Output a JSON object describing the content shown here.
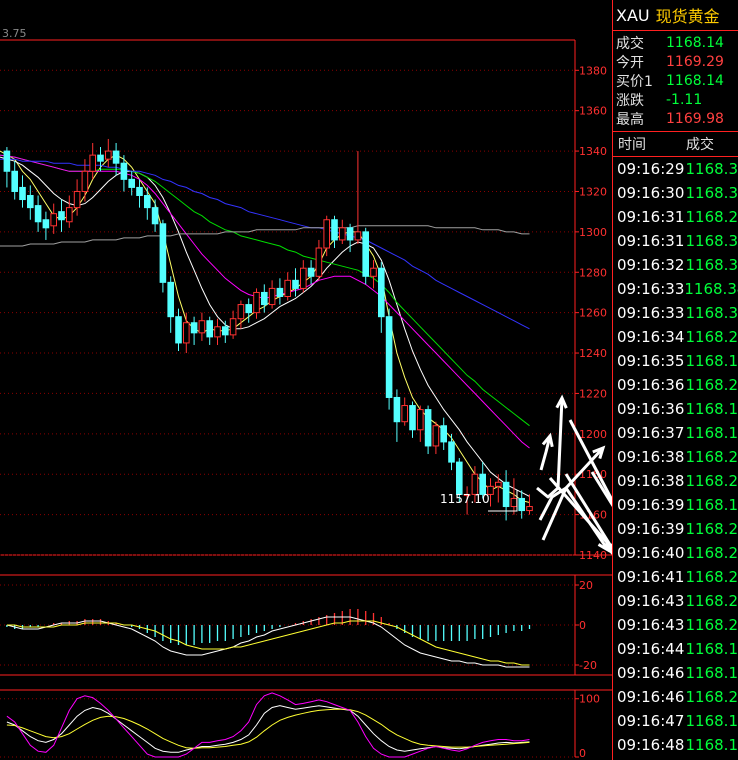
{
  "chart_data": {
    "type": "candlestick",
    "y_ticks": [
      "1380",
      "1360",
      "1340",
      "1320",
      "1300",
      "1280",
      "1260",
      "1240",
      "1220",
      "1200",
      "1180",
      "1160",
      "1140"
    ],
    "ylim": [
      1140,
      1395
    ],
    "top_left_label": "3.75",
    "annotation_low": "1157.10",
    "candles": [
      [
        1340,
        1330,
        1342,
        1322
      ],
      [
        1330,
        1320,
        1335,
        1316
      ],
      [
        1322,
        1316,
        1328,
        1312
      ],
      [
        1318,
        1312,
        1323,
        1306
      ],
      [
        1313,
        1305,
        1318,
        1300
      ],
      [
        1306,
        1302,
        1310,
        1296
      ],
      [
        1303,
        1309,
        1314,
        1299
      ],
      [
        1310,
        1306,
        1316,
        1300
      ],
      [
        1305,
        1312,
        1318,
        1302
      ],
      [
        1312,
        1320,
        1326,
        1308
      ],
      [
        1320,
        1330,
        1336,
        1315
      ],
      [
        1330,
        1338,
        1344,
        1326
      ],
      [
        1338,
        1335,
        1342,
        1330
      ],
      [
        1336,
        1340,
        1346,
        1332
      ],
      [
        1340,
        1334,
        1344,
        1328
      ],
      [
        1334,
        1326,
        1338,
        1320
      ],
      [
        1326,
        1322,
        1330,
        1318
      ],
      [
        1322,
        1318,
        1326,
        1312
      ],
      [
        1318,
        1312,
        1322,
        1306
      ],
      [
        1312,
        1304,
        1316,
        1300
      ],
      [
        1304,
        1275,
        1306,
        1270
      ],
      [
        1275,
        1258,
        1278,
        1250
      ],
      [
        1258,
        1245,
        1262,
        1241
      ],
      [
        1245,
        1255,
        1260,
        1240
      ],
      [
        1255,
        1250,
        1258,
        1244
      ],
      [
        1250,
        1256,
        1260,
        1246
      ],
      [
        1256,
        1248,
        1258,
        1244
      ],
      [
        1248,
        1253,
        1257,
        1244
      ],
      [
        1253,
        1249,
        1256,
        1245
      ],
      [
        1249,
        1257,
        1261,
        1247
      ],
      [
        1257,
        1264,
        1266,
        1252
      ],
      [
        1264,
        1260,
        1267,
        1255
      ],
      [
        1260,
        1270,
        1272,
        1257
      ],
      [
        1270,
        1264,
        1274,
        1260
      ],
      [
        1264,
        1272,
        1276,
        1262
      ],
      [
        1272,
        1268,
        1277,
        1264
      ],
      [
        1268,
        1276,
        1280,
        1266
      ],
      [
        1276,
        1272,
        1282,
        1268
      ],
      [
        1272,
        1282,
        1286,
        1270
      ],
      [
        1282,
        1278,
        1286,
        1274
      ],
      [
        1278,
        1292,
        1296,
        1276
      ],
      [
        1292,
        1306,
        1308,
        1288
      ],
      [
        1306,
        1296,
        1308,
        1292
      ],
      [
        1296,
        1302,
        1306,
        1294
      ],
      [
        1302,
        1296,
        1304,
        1290
      ],
      [
        1296,
        1300,
        1340,
        1294
      ],
      [
        1300,
        1278,
        1302,
        1274
      ],
      [
        1278,
        1282,
        1286,
        1272
      ],
      [
        1282,
        1258,
        1285,
        1250
      ],
      [
        1258,
        1218,
        1262,
        1212
      ],
      [
        1218,
        1206,
        1222,
        1196
      ],
      [
        1206,
        1214,
        1218,
        1204
      ],
      [
        1214,
        1202,
        1216,
        1198
      ],
      [
        1202,
        1212,
        1214,
        1196
      ],
      [
        1212,
        1194,
        1214,
        1190
      ],
      [
        1194,
        1204,
        1206,
        1190
      ],
      [
        1204,
        1196,
        1208,
        1192
      ],
      [
        1196,
        1186,
        1200,
        1182
      ],
      [
        1186,
        1170,
        1188,
        1166
      ],
      [
        1170,
        1170,
        1174,
        1160
      ],
      [
        1170,
        1180,
        1184,
        1166
      ],
      [
        1180,
        1170,
        1186,
        1168
      ],
      [
        1170,
        1174,
        1178,
        1164
      ],
      [
        1174,
        1176,
        1180,
        1166
      ],
      [
        1176,
        1164,
        1182,
        1157.1
      ],
      [
        1164,
        1168,
        1178,
        1160
      ],
      [
        1168,
        1162,
        1172,
        1158
      ],
      [
        1162,
        1164,
        1170,
        1160
      ]
    ],
    "ma": [
      {
        "color": "#ffff66",
        "values": [
          1340,
          1336,
          1330,
          1326,
          1320,
          1314,
          1308,
          1306,
          1308,
          1312,
          1318,
          1326,
          1332,
          1336,
          1338,
          1336,
          1332,
          1326,
          1320,
          1314,
          1300,
          1284,
          1268,
          1256,
          1252,
          1250,
          1252,
          1251,
          1251,
          1252,
          1255,
          1258,
          1261,
          1263,
          1266,
          1268,
          1270,
          1272,
          1275,
          1278,
          1284,
          1292,
          1296,
          1299,
          1300,
          1300,
          1294,
          1288,
          1278,
          1258,
          1240,
          1228,
          1218,
          1212,
          1208,
          1205,
          1202,
          1198,
          1192,
          1186,
          1180,
          1176,
          1172,
          1174,
          1172,
          1170,
          1167,
          1166
        ]
      },
      {
        "color": "#ffffff",
        "values": [
          1337,
          1335,
          1333,
          1330,
          1327,
          1323,
          1319,
          1316,
          1314,
          1313,
          1314,
          1317,
          1321,
          1325,
          1328,
          1330,
          1330,
          1329,
          1327,
          1323,
          1317,
          1309,
          1300,
          1290,
          1281,
          1272,
          1264,
          1258,
          1254,
          1252,
          1252,
          1253,
          1255,
          1257,
          1260,
          1263,
          1265,
          1267,
          1270,
          1273,
          1277,
          1282,
          1286,
          1290,
          1293,
          1295,
          1294,
          1292,
          1286,
          1276,
          1264,
          1252,
          1241,
          1232,
          1224,
          1218,
          1212,
          1207,
          1202,
          1196,
          1191,
          1186,
          1181,
          1178,
          1175,
          1173,
          1171,
          1169
        ]
      },
      {
        "color": "#00dd00",
        "values": [
          1338,
          1337,
          1336,
          1335,
          1334,
          1333,
          1332,
          1331,
          1330,
          1330,
          1330,
          1330,
          1331,
          1331,
          1331,
          1331,
          1330,
          1329,
          1327,
          1325,
          1322,
          1319,
          1316,
          1313,
          1310,
          1308,
          1305,
          1303,
          1301,
          1300,
          1298,
          1297,
          1296,
          1295,
          1294,
          1293,
          1291,
          1290,
          1288,
          1287,
          1286,
          1285,
          1284,
          1283,
          1282,
          1281,
          1279,
          1277,
          1274,
          1270,
          1265,
          1261,
          1257,
          1253,
          1249,
          1245,
          1241,
          1237,
          1233,
          1229,
          1226,
          1222,
          1219,
          1216,
          1213,
          1210,
          1207,
          1204
        ]
      },
      {
        "color": "#ff00ff",
        "values": [
          1338,
          1337,
          1336,
          1335,
          1334,
          1333,
          1332,
          1331,
          1330,
          1330,
          1330,
          1330,
          1330,
          1330,
          1330,
          1329,
          1328,
          1326,
          1323,
          1319,
          1314,
          1309,
          1304,
          1299,
          1294,
          1289,
          1285,
          1281,
          1277,
          1274,
          1271,
          1269,
          1268,
          1267,
          1268,
          1269,
          1270,
          1271,
          1272,
          1274,
          1276,
          1277,
          1278,
          1278,
          1278,
          1276,
          1274,
          1271,
          1268,
          1264,
          1260,
          1256,
          1252,
          1248,
          1244,
          1240,
          1236,
          1232,
          1228,
          1224,
          1220,
          1216,
          1212,
          1208,
          1204,
          1200,
          1196,
          1193
        ]
      },
      {
        "color": "#3333ff",
        "values": [
          1336,
          1336,
          1335,
          1335,
          1335,
          1335,
          1334,
          1334,
          1334,
          1333,
          1333,
          1333,
          1333,
          1332,
          1332,
          1331,
          1330,
          1330,
          1329,
          1328,
          1326,
          1325,
          1323,
          1322,
          1320,
          1319,
          1317,
          1316,
          1314,
          1313,
          1312,
          1310,
          1309,
          1308,
          1307,
          1306,
          1305,
          1304,
          1303,
          1302,
          1302,
          1301,
          1300,
          1299,
          1298,
          1297,
          1296,
          1294,
          1292,
          1290,
          1288,
          1286,
          1283,
          1281,
          1279,
          1276,
          1274,
          1272,
          1270,
          1268,
          1266,
          1264,
          1262,
          1260,
          1258,
          1256,
          1254,
          1252
        ]
      },
      {
        "color": "#a0a0a0",
        "values": [
          1293,
          1293,
          1293,
          1294,
          1294,
          1294,
          1294,
          1295,
          1295,
          1295,
          1295,
          1296,
          1296,
          1296,
          1296,
          1297,
          1297,
          1297,
          1298,
          1298,
          1298,
          1298,
          1299,
          1299,
          1299,
          1299,
          1299,
          1299,
          1300,
          1300,
          1300,
          1300,
          1301,
          1301,
          1301,
          1301,
          1301,
          1301,
          1302,
          1302,
          1302,
          1302,
          1302,
          1302,
          1302,
          1303,
          1303,
          1303,
          1303,
          1303,
          1303,
          1303,
          1303,
          1303,
          1303,
          1302,
          1302,
          1302,
          1302,
          1302,
          1302,
          1301,
          1301,
          1301,
          1300,
          1300,
          1299,
          1299
        ]
      }
    ],
    "macd": {
      "y_ticks": [
        "20",
        "0",
        "-20"
      ],
      "ylim": [
        -25,
        25
      ],
      "hist": [
        -1,
        -2,
        -2,
        -1,
        -1,
        0,
        1,
        1,
        2,
        2,
        3,
        3,
        3,
        2,
        1,
        0,
        -1,
        -2,
        -4,
        -6,
        -8,
        -9,
        -10,
        -10,
        -10,
        -9,
        -9,
        -8,
        -8,
        -7,
        -6,
        -5,
        -4,
        -3,
        -2,
        -1,
        0,
        1,
        2,
        3,
        4,
        5,
        6,
        7,
        8,
        8,
        7,
        6,
        4,
        1,
        -2,
        -4,
        -6,
        -7,
        -8,
        -8,
        -8,
        -8,
        -8,
        -8,
        -7,
        -7,
        -6,
        -5,
        -4,
        -3,
        -3,
        -2
      ],
      "dif": [
        0,
        -1,
        -2,
        -2,
        -2,
        -1,
        0,
        1,
        1,
        1,
        2,
        2,
        2,
        1,
        0,
        -1,
        -2,
        -4,
        -6,
        -8,
        -11,
        -13,
        -14,
        -15,
        -15,
        -15,
        -14,
        -13,
        -12,
        -11,
        -9,
        -8,
        -6,
        -5,
        -3,
        -2,
        -1,
        0,
        1,
        2,
        3,
        4,
        4,
        4,
        4,
        3,
        2,
        1,
        -1,
        -4,
        -7,
        -10,
        -12,
        -14,
        -15,
        -16,
        -17,
        -18,
        -18,
        -19,
        -19,
        -20,
        -20,
        -20,
        -21,
        -21,
        -21,
        -21
      ],
      "dea": [
        0,
        0,
        -1,
        -1,
        -1,
        -1,
        -1,
        0,
        0,
        0,
        1,
        1,
        1,
        1,
        1,
        0,
        0,
        -1,
        -2,
        -3,
        -5,
        -7,
        -8,
        -10,
        -11,
        -12,
        -12,
        -12,
        -12,
        -11,
        -11,
        -10,
        -9,
        -8,
        -7,
        -6,
        -5,
        -4,
        -3,
        -2,
        -1,
        0,
        1,
        1,
        2,
        2,
        2,
        2,
        1,
        0,
        -1,
        -3,
        -5,
        -7,
        -9,
        -11,
        -12,
        -13,
        -14,
        -15,
        -16,
        -17,
        -18,
        -18,
        -19,
        -19,
        -20,
        -20
      ]
    },
    "kdj": {
      "y_ticks": [
        "100",
        "0"
      ],
      "ylim": [
        0,
        115
      ],
      "k": [
        60,
        55,
        45,
        35,
        28,
        25,
        30,
        40,
        55,
        70,
        80,
        85,
        82,
        75,
        65,
        55,
        45,
        35,
        25,
        15,
        10,
        8,
        8,
        12,
        15,
        18,
        18,
        20,
        22,
        25,
        30,
        38,
        55,
        75,
        85,
        88,
        85,
        82,
        84,
        86,
        88,
        86,
        84,
        82,
        80,
        70,
        55,
        40,
        28,
        18,
        12,
        10,
        12,
        14,
        16,
        18,
        16,
        15,
        14,
        16,
        18,
        20,
        22,
        24,
        25,
        24,
        25,
        26
      ],
      "d": [
        55,
        54,
        50,
        45,
        40,
        35,
        33,
        35,
        40,
        48,
        56,
        63,
        68,
        70,
        69,
        66,
        61,
        55,
        48,
        40,
        32,
        26,
        20,
        16,
        15,
        16,
        16,
        17,
        18,
        20,
        22,
        26,
        34,
        45,
        55,
        63,
        68,
        72,
        75,
        78,
        80,
        81,
        82,
        82,
        81,
        78,
        72,
        64,
        56,
        46,
        38,
        32,
        26,
        22,
        20,
        19,
        18,
        17,
        17,
        17,
        18,
        19,
        20,
        21,
        22,
        23,
        24,
        25
      ],
      "j": [
        70,
        60,
        40,
        20,
        10,
        8,
        20,
        50,
        80,
        100,
        105,
        102,
        92,
        80,
        65,
        50,
        35,
        20,
        5,
        0,
        0,
        0,
        0,
        5,
        15,
        25,
        25,
        28,
        30,
        35,
        45,
        60,
        90,
        105,
        110,
        105,
        98,
        90,
        92,
        95,
        98,
        95,
        90,
        85,
        80,
        60,
        35,
        15,
        5,
        0,
        0,
        0,
        5,
        10,
        15,
        18,
        15,
        12,
        10,
        14,
        20,
        25,
        28,
        30,
        30,
        28,
        28,
        30
      ]
    }
  },
  "sidebar": {
    "code": "XAU",
    "name": "现货黄金",
    "quote": [
      {
        "label": "成交",
        "value": "1168.14",
        "color": "#00ff3a"
      },
      {
        "label": "今开",
        "value": "1169.29",
        "color": "#ff4040"
      },
      {
        "label": "买价1",
        "value": "1168.14",
        "color": "#00ff3a"
      },
      {
        "label": "涨跌",
        "value": "-1.11",
        "color": "#00ff3a"
      },
      {
        "label": "最高",
        "value": "1169.98",
        "color": "#ff4040"
      }
    ],
    "ticks_header": {
      "time": "时间",
      "price": "成交"
    },
    "ticks": [
      {
        "time": "09:16:29",
        "price": "1168.3"
      },
      {
        "time": "09:16:30",
        "price": "1168.3"
      },
      {
        "time": "09:16:31",
        "price": "1168.2"
      },
      {
        "time": "09:16:31",
        "price": "1168.3"
      },
      {
        "time": "09:16:32",
        "price": "1168.3"
      },
      {
        "time": "09:16:33",
        "price": "1168.34"
      },
      {
        "time": "09:16:33",
        "price": "1168.3"
      },
      {
        "time": "09:16:34",
        "price": "1168.2"
      },
      {
        "time": "09:16:35",
        "price": "1168.1"
      },
      {
        "time": "09:16:36",
        "price": "1168.2"
      },
      {
        "time": "09:16:36",
        "price": "1168.1"
      },
      {
        "time": "09:16:37",
        "price": "1168.1"
      },
      {
        "time": "09:16:38",
        "price": "1168.2"
      },
      {
        "time": "09:16:38",
        "price": "1168.2"
      },
      {
        "time": "09:16:39",
        "price": "1168.1"
      },
      {
        "time": "09:16:39",
        "price": "1168.2"
      },
      {
        "time": "09:16:40",
        "price": "1168.2"
      },
      {
        "time": "09:16:41",
        "price": "1168.2"
      },
      {
        "time": "09:16:43",
        "price": "1168.2"
      },
      {
        "time": "09:16:43",
        "price": "1168.2"
      },
      {
        "time": "09:16:44",
        "price": "1168.1"
      },
      {
        "time": "09:16:46",
        "price": "1168.1"
      },
      {
        "time": "09:16:46",
        "price": "1168.2"
      },
      {
        "time": "09:16:47",
        "price": "1168.1"
      },
      {
        "time": "09:16:48",
        "price": "1168.1"
      }
    ]
  }
}
